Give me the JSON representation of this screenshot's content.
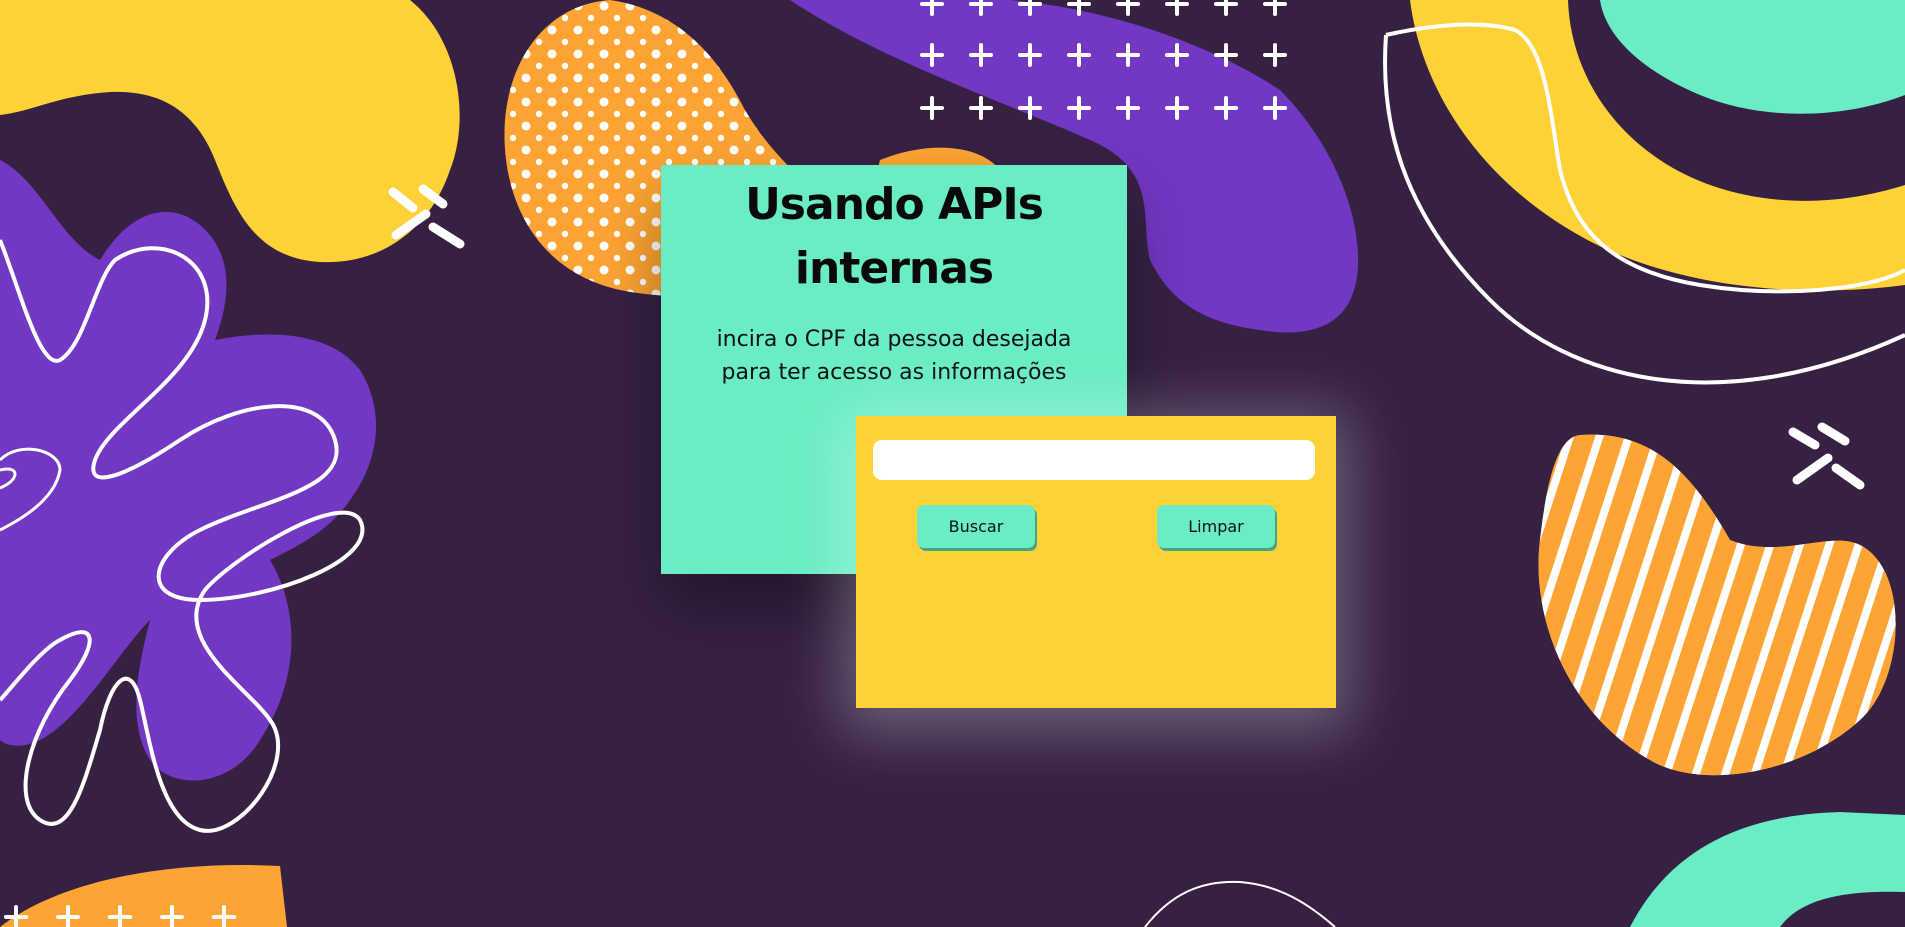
{
  "panel": {
    "title_line1": "Usando APIs",
    "title_line2": "internas",
    "subtitle_line1": "incira o CPF da pessoa desejada",
    "subtitle_line2": "para ter acesso as informações"
  },
  "form": {
    "input_value": "",
    "search_label": "Buscar",
    "clear_label": "Limpar"
  },
  "colors": {
    "background": "#372143",
    "purple": "#7237c3",
    "yellow": "#fed136",
    "orange": "#fda434",
    "mint": "#6aedc4",
    "white": "#ffffff"
  }
}
